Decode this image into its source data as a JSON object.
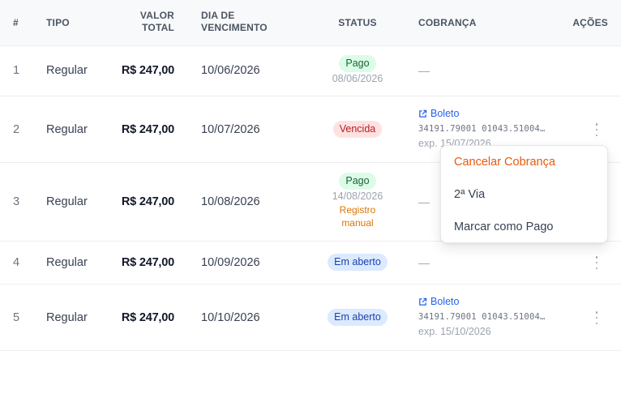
{
  "headers": {
    "num": "#",
    "tipo": "TIPO",
    "valor_line1": "VALOR",
    "valor_line2": "TOTAL",
    "dia_line1": "DIA DE",
    "dia_line2": "VENCIMENTO",
    "status": "STATUS",
    "cobranca": "COBRANÇA",
    "acoes": "AÇÕES"
  },
  "rows": [
    {
      "num": "1",
      "tipo": "Regular",
      "valor": "R$ 247,00",
      "vencimento": "10/06/2026",
      "status": "Pago",
      "status_date": "08/06/2026",
      "cobranca": "—"
    },
    {
      "num": "2",
      "tipo": "Regular",
      "valor": "R$ 247,00",
      "vencimento": "10/07/2026",
      "status": "Vencida",
      "boleto_label": "Boleto",
      "boleto_code": "34191.79001 01043.51004…",
      "exp": "exp. 15/07/2026"
    },
    {
      "num": "3",
      "tipo": "Regular",
      "valor": "R$ 247,00",
      "vencimento": "10/08/2026",
      "status": "Pago",
      "status_date": "14/08/2026",
      "note_line1": "Registro",
      "note_line2": "manual",
      "cobranca": "—"
    },
    {
      "num": "4",
      "tipo": "Regular",
      "valor": "R$ 247,00",
      "vencimento": "10/09/2026",
      "status": "Em aberto",
      "cobranca": "—"
    },
    {
      "num": "5",
      "tipo": "Regular",
      "valor": "R$ 247,00",
      "vencimento": "10/10/2026",
      "status": "Em aberto",
      "boleto_label": "Boleto",
      "boleto_code": "34191.79001 01043.51004…",
      "exp": "exp. 15/10/2026"
    }
  ],
  "menu": {
    "items": [
      "Cancelar Cobrança",
      "2ª Via",
      "Marcar como Pago"
    ]
  },
  "colors": {
    "paid": "#dcfce7",
    "overdue": "#fee2e2",
    "open": "#dbeafe",
    "danger": "#ea580c",
    "link": "#2563eb"
  },
  "icons": {
    "boleto": "external-link-icon",
    "actions": "kebab-icon"
  }
}
